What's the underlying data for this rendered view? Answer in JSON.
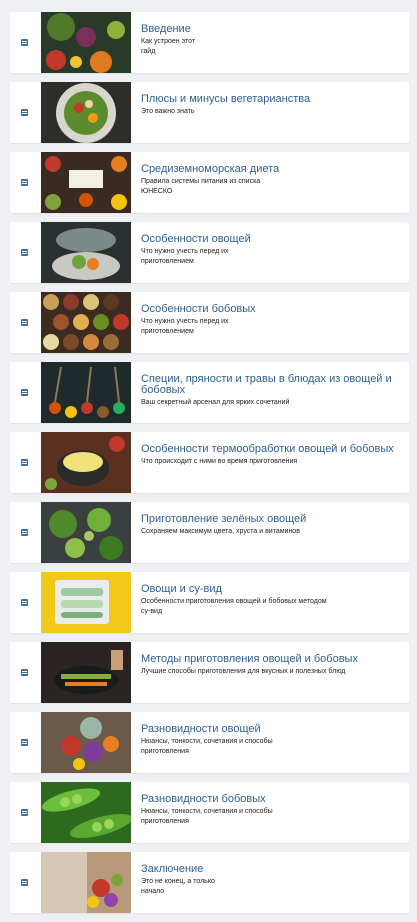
{
  "colors": {
    "accent": "#2e5f8e",
    "icon": "#3d6fa0",
    "background": "#eef0f3"
  },
  "lessons": [
    {
      "icon": "document-icon",
      "title": "Введение",
      "description": "Как устроен этот\nгайд"
    },
    {
      "icon": "document-icon",
      "title": "Плюсы и минусы вегетарианства",
      "description": "Это важно знать"
    },
    {
      "icon": "document-icon",
      "title": "Средиземноморская диета",
      "description": "Правила системы питания из списка\nЮНЕСКО"
    },
    {
      "icon": "document-icon",
      "title": "Особенности овощей",
      "description": "Что нужно учесть перед их\nприготовлением"
    },
    {
      "icon": "document-icon",
      "title": "Особенности бобовых",
      "description": "Что нужно учесть перед их\nприготовлением"
    },
    {
      "icon": "document-icon",
      "title": "Специи, пряности и травы в блюдах из овощей и бобовых",
      "description": "Ваш секретный арсенал для ярких сочетаний"
    },
    {
      "icon": "document-icon",
      "title": "Особенности термообработки овощей и бобовых",
      "description": "Что происходит с ними во время приготовления"
    },
    {
      "icon": "document-icon",
      "title": "Приготовление зелёных овощей",
      "description": "Сохраняем максимум цвета, хруста и витаминов"
    },
    {
      "icon": "document-icon",
      "title": "Овощи и су-вид",
      "description": "Особенности приготовления овощей и бобовых методом\nсу-вид"
    },
    {
      "icon": "document-icon",
      "title": "Методы приготовления овощей и бобовых",
      "description": "Лучшие способы приготовления для вкусных и полезных блюд"
    },
    {
      "icon": "document-icon",
      "title": "Разновидности овощей",
      "description": "Нюансы, тонкости, сочетания и способы\nприготовления"
    },
    {
      "icon": "document-icon",
      "title": "Разновидности бобовых",
      "description": "Нюансы, тонкости, сочетания и способы\nприготовления"
    },
    {
      "icon": "document-icon",
      "title": "Заключение",
      "description": "Это не конец, а только\nначало"
    }
  ]
}
